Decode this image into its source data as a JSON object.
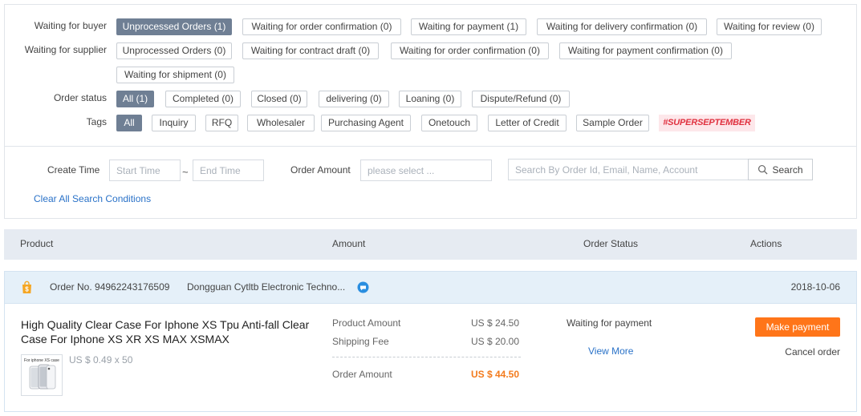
{
  "filters": {
    "buyer": {
      "label": "Waiting for buyer",
      "chips": [
        "Unprocessed Orders (1)",
        "Waiting for order confirmation (0)",
        "Waiting for payment (1)",
        "Waiting for delivery confirmation (0)",
        "Waiting for review (0)"
      ]
    },
    "supplier": {
      "label": "Waiting for supplier",
      "chips": [
        "Unprocessed Orders (0)",
        "Waiting for contract draft (0)",
        "Waiting for order confirmation (0)",
        "Waiting for payment confirmation (0)",
        "Waiting for shipment (0)"
      ]
    },
    "status": {
      "label": "Order status",
      "chips": [
        "All (1)",
        "Completed (0)",
        "Closed (0)",
        "delivering (0)",
        "Loaning (0)",
        "Dispute/Refund (0)"
      ]
    },
    "tags": {
      "label": "Tags",
      "chips": [
        "All",
        "Inquiry",
        "RFQ",
        "Wholesaler",
        "Purchasing Agent",
        "Onetouch",
        "Letter of Credit",
        "Sample Order"
      ],
      "promo": "#SUPERSEPTEMBER"
    }
  },
  "search": {
    "create_time_label": "Create Time",
    "start_placeholder": "Start Time",
    "end_placeholder": "End Time",
    "tilde": "~",
    "amount_label": "Order Amount",
    "amount_placeholder": "please select ...",
    "query_placeholder": "Search By Order Id, Email, Name, Account",
    "search_label": "Search",
    "clear_label": "Clear All Search Conditions"
  },
  "table_header": {
    "product": "Product",
    "amount": "Amount",
    "order_status": "Order Status",
    "actions": "Actions"
  },
  "order": {
    "order_no": "Order No. 94962243176509",
    "supplier": "Dongguan Cytltb Electronic Techno...",
    "date": "2018-10-06",
    "product_title": "High Quality Clear Case For Iphone XS Tpu Anti-fall Clear Case For Iphone XS XR XS MAX XSMAX",
    "thumb_caption": "For iphone XS case",
    "unit_price": "US $ 0.49 x 50",
    "product_amount_label": "Product Amount",
    "product_amount": "US $ 24.50",
    "shipping_label": "Shipping Fee",
    "shipping": "US $ 20.00",
    "order_amount_label": "Order Amount",
    "order_amount": "US $ 44.50",
    "status": "Waiting for payment",
    "view_more": "View More",
    "pay_label": "Make payment",
    "cancel_label": "Cancel order"
  },
  "colors": {
    "accent_orange": "#ff7519",
    "link_blue": "#2a72c8",
    "active_chip": "#6f7f94",
    "header_bar": "#e6ebf2",
    "order_bar": "#e5f0f9",
    "promo_red": "#e0313f"
  },
  "icons": {
    "bag": "shopping-bag-icon",
    "chat": "chat-icon",
    "search": "search-icon"
  }
}
